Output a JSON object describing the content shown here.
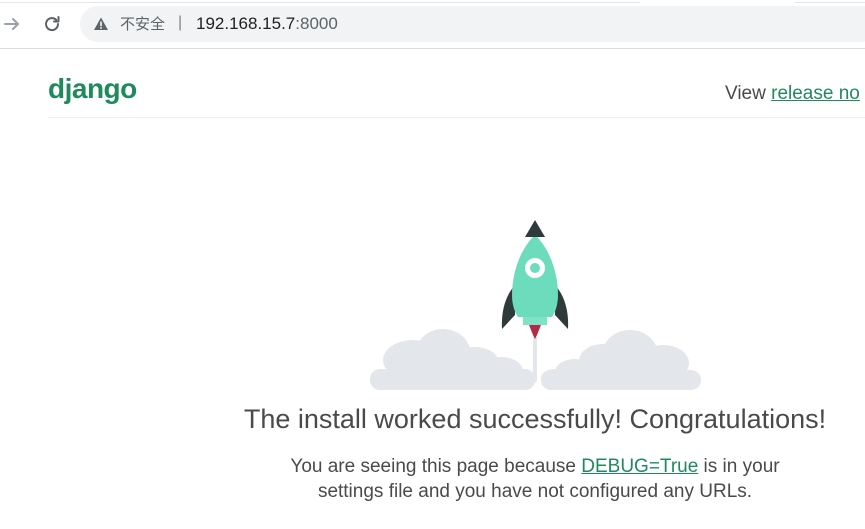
{
  "browser": {
    "forward_icon": "arrow-right-icon",
    "reload_icon": "reload-icon",
    "security_icon": "warning-triangle-icon",
    "security_label": "不安全",
    "separator": "|",
    "url_host": "192.168.15.7",
    "url_port": ":8000"
  },
  "header": {
    "logo": "django",
    "release_prefix": "View ",
    "release_link": "release no"
  },
  "main": {
    "illustration_icon": "rocket-launch-icon",
    "headline": "The install worked successfully! Congratulations!",
    "sub_line1_before": "You are seeing this page because ",
    "debug_link": "DEBUG=True",
    "sub_line1_after": " is in your",
    "sub_line2": "settings file and you have not configured any URLs."
  },
  "colors": {
    "brand_green": "#1f8a5b",
    "rocket_body": "#6ddcbd",
    "rocket_dark": "#2f3a3a",
    "flame": "#b32a47",
    "cloud": "#e3e6ea",
    "text": "#4a4a4a"
  }
}
